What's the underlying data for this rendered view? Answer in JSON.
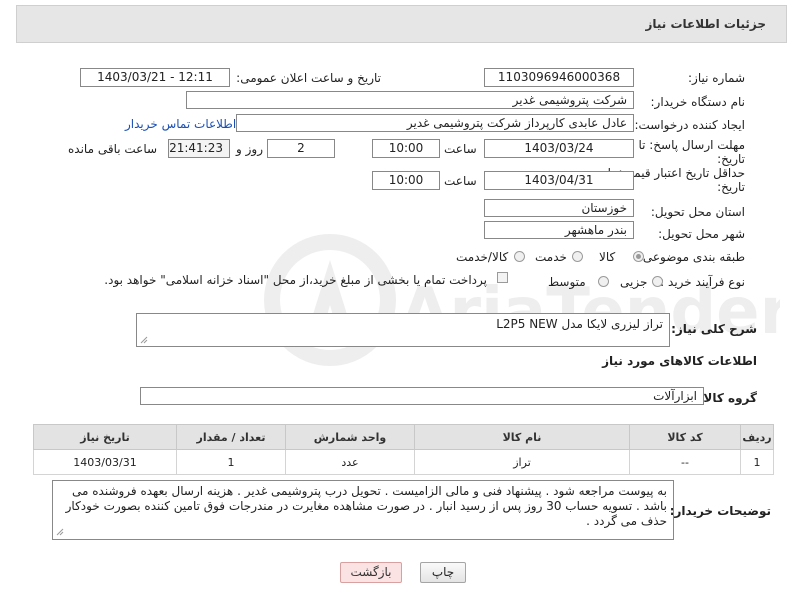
{
  "header": {
    "title": "جزئیات اطلاعات نیاز"
  },
  "form": {
    "need_number_label": "شماره نیاز:",
    "need_number": "1103096946000368",
    "announce_label": "تاریخ و ساعت اعلان عمومی:",
    "announce_value": "1403/03/21 - 12:11",
    "buyer_org_label": "نام دستگاه خریدار:",
    "buyer_org": "شرکت پتروشیمی غدیر",
    "creator_label": "ایجاد کننده درخواست:",
    "creator": "عادل عابدی کارپرداز شرکت پتروشیمی غدیر",
    "contact_link": "اطلاعات تماس خریدار",
    "deadline_label_1": "مهلت ارسال پاسخ: تا",
    "deadline_label_2": "تاریخ:",
    "deadline_date": "1403/03/24",
    "time_label": "ساعت",
    "deadline_time": "10:00",
    "days_value": "2",
    "days_label": "روز و",
    "remaining_time": "21:41:23",
    "remaining_label": "ساعت باقی مانده",
    "validity_label_1": "حداقل تاریخ اعتبار قیمت: تا",
    "validity_label_2": "تاریخ:",
    "validity_date": "1403/04/31",
    "validity_time_label": "ساعت",
    "validity_time": "10:00",
    "province_label": "استان محل تحویل:",
    "province": "خوزستان",
    "city_label": "شهر محل تحویل:",
    "city": "بندر ماهشهر",
    "category_label": "طبقه بندی موضوعی:",
    "category_options": [
      "کالا",
      "خدمت",
      "کالا/خدمت"
    ],
    "category_selected": "کالا",
    "process_label": "نوع فرآیند خرید :",
    "process_options": [
      "جزیی",
      "متوسط"
    ],
    "payment_note": "پرداخت تمام یا بخشی از مبلغ خرید،از محل \"اسناد خزانه اسلامی\" خواهد بود."
  },
  "summary": {
    "label": "شرح کلی نیاز:",
    "value": "تراز لیزری لایکا مدل L2P5  NEW"
  },
  "goods": {
    "section_title": "اطلاعات کالاهای مورد نیاز",
    "group_label": "گروه کالا:",
    "group_value": "ابزارآلات",
    "columns": [
      "ردیف",
      "کد کالا",
      "نام کالا",
      "واحد شمارش",
      "تعداد / مقدار",
      "تاریخ نیاز"
    ],
    "rows": [
      [
        "1",
        "--",
        "تراز",
        "عدد",
        "1",
        "1403/03/31"
      ]
    ]
  },
  "notes": {
    "label": "توضیحات خریدار:",
    "text": "به پیوست مراجعه شود . پیشنهاد فنی و مالی الزامیست . تحویل درب پتروشیمی غدیر . هزینه ارسال بعهده فروشنده می باشد . تسویه حساب 30 روز پس از رسید انبار .  در صورت مشاهده مغایرت در مندرجات فوق تامین کننده بصورت خودکار حذف می گردد ."
  },
  "buttons": {
    "print": "چاپ",
    "back": "بازگشت"
  },
  "watermark": {
    "text": "AriaTender.neT"
  },
  "colors": {
    "link": "#1a4fb5",
    "header_bg": "#e6e6e6",
    "table_header_bg": "#e3e3e3",
    "back_button_bg": "#fbe3e3"
  }
}
